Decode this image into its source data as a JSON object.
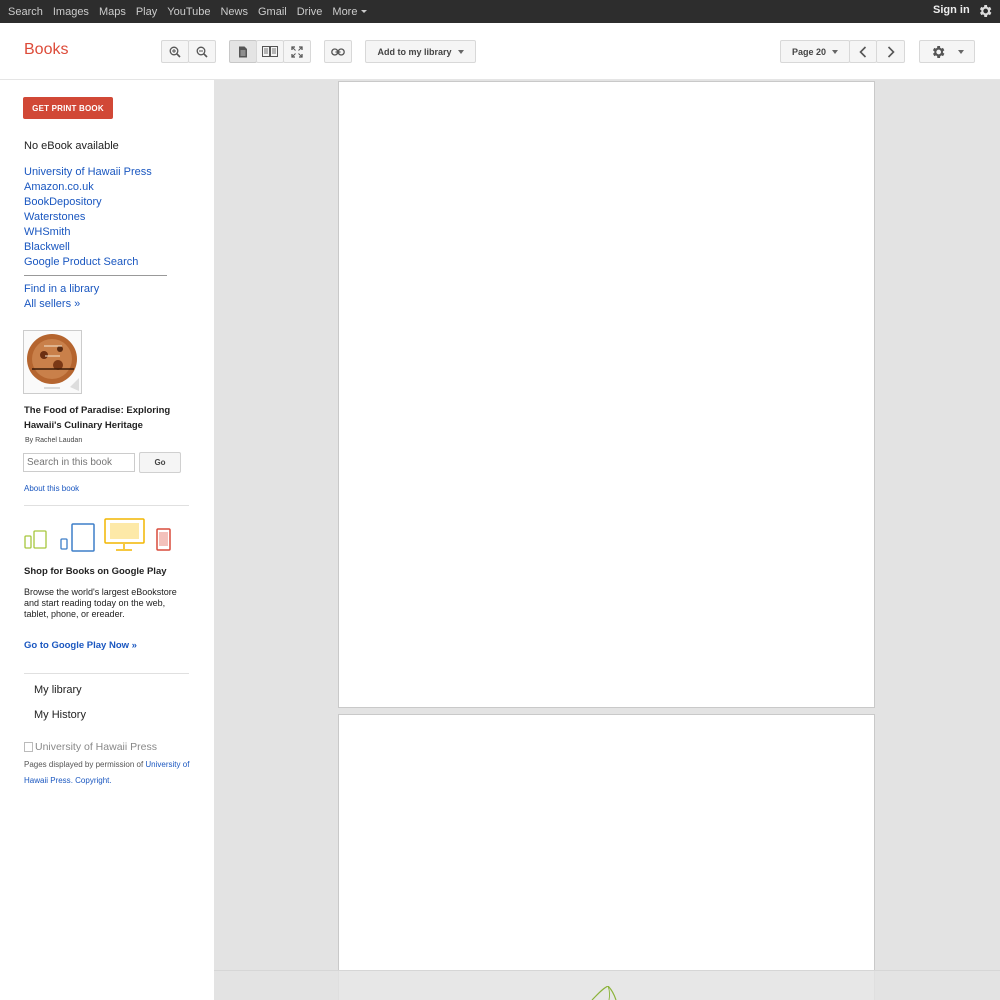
{
  "topbar": {
    "links": [
      "Search",
      "Images",
      "Maps",
      "Play",
      "YouTube",
      "News",
      "Gmail",
      "Drive",
      "More"
    ],
    "signin": "Sign in"
  },
  "header": {
    "logo": "Books",
    "add_library": "Add to my library",
    "page_label": "Page 20"
  },
  "sidebar": {
    "print_button": "GET PRINT BOOK",
    "no_ebook": "No eBook available",
    "sellers": [
      "University of Hawaii Press",
      "Amazon.co.uk",
      "BookDepository",
      "Waterstones",
      "WHSmith",
      "Blackwell",
      "Google Product Search"
    ],
    "find_library": "Find in a library",
    "all_sellers": "All sellers »",
    "book_title": "The Food of Paradise: Exploring Hawaii's Culinary Heritage",
    "author": "By Rachel Laudan",
    "search_placeholder": "Search in this book",
    "go": "Go",
    "about": "About this book",
    "shop_title": "Shop for Books on Google Play",
    "shop_desc": "Browse the world's largest eBookstore and start reading today on the web, tablet, phone, or ereader.",
    "go_play": "Go to Google Play Now »",
    "my_library": "My library",
    "my_history": "My History",
    "publisher_logo_alt": "University of Hawaii Press",
    "permission_prefix": "Pages displayed by permission of ",
    "permission_link": "University of Hawaii Press",
    "copyright": "Copyright"
  },
  "colors": {
    "topbar": "#2d2d2d",
    "brand_red": "#dd4b39",
    "link_blue": "#1a57c0",
    "print_button": "#d14836",
    "viewer_bg": "#e3e3e3"
  },
  "icons": [
    "gear-icon",
    "zoom-in-icon",
    "zoom-out-icon",
    "single-page-icon",
    "two-page-icon",
    "fullscreen-icon",
    "link-icon",
    "prev-icon",
    "next-icon",
    "settings-icon"
  ]
}
